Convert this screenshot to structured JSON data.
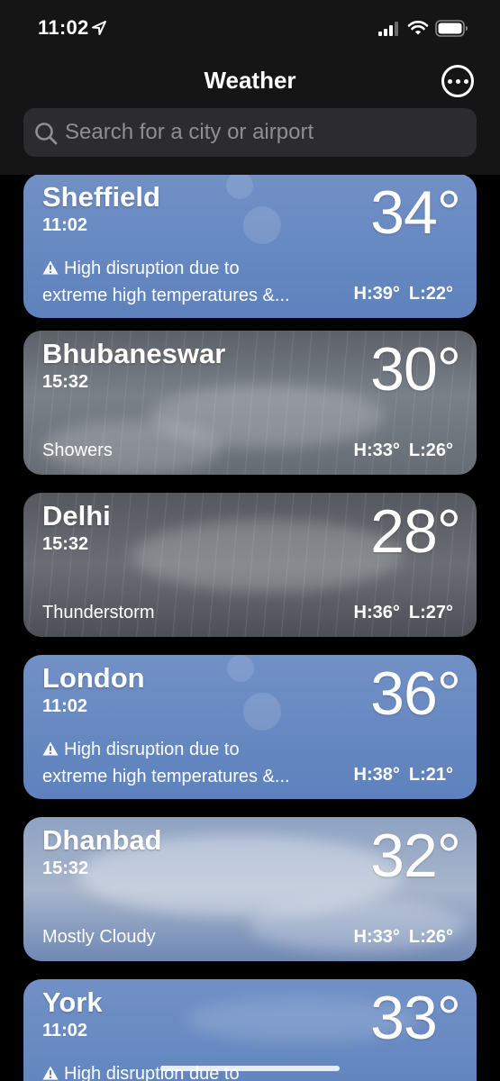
{
  "status_bar": {
    "time": "11:02"
  },
  "header": {
    "title": "Weather",
    "more_icon": "ellipsis-circle-icon"
  },
  "search": {
    "placeholder": "Search for a city or airport"
  },
  "colors": {
    "background": "#000000",
    "header": "#151515",
    "search_bg": "#2c2c2e",
    "placeholder": "#8e8e93"
  },
  "cities": [
    {
      "name": "Sheffield",
      "time": "11:02",
      "temp": "34°",
      "alert_line1": "High disruption due to",
      "alert_line2": "extreme high temperatures &...",
      "high": "H:39°",
      "low": "L:22°"
    },
    {
      "name": "Bhubaneswar",
      "time": "15:32",
      "temp": "30°",
      "condition": "Showers",
      "high": "H:33°",
      "low": "L:26°"
    },
    {
      "name": "Delhi",
      "time": "15:32",
      "temp": "28°",
      "condition": "Thunderstorm",
      "high": "H:36°",
      "low": "L:27°"
    },
    {
      "name": "London",
      "time": "11:02",
      "temp": "36°",
      "alert_line1": "High disruption due to",
      "alert_line2": "extreme high temperatures &...",
      "high": "H:38°",
      "low": "L:21°"
    },
    {
      "name": "Dhanbad",
      "time": "15:32",
      "temp": "32°",
      "condition": "Mostly Cloudy",
      "high": "H:33°",
      "low": "L:26°"
    },
    {
      "name": "York",
      "time": "11:02",
      "temp": "33°",
      "alert_line1": "High disruption due to"
    }
  ]
}
